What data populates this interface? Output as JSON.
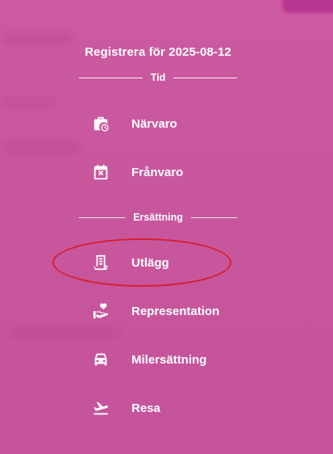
{
  "title": "Registrera för 2025-08-12",
  "sections": [
    {
      "heading": "Tid",
      "items": [
        {
          "label": "Närvaro",
          "icon": "briefcase-clock-icon"
        },
        {
          "label": "Frånvaro",
          "icon": "calendar-x-icon"
        }
      ]
    },
    {
      "heading": "Ersättning",
      "items": [
        {
          "label": "Utlägg",
          "icon": "receipt-icon"
        },
        {
          "label": "Representation",
          "icon": "hand-heart-icon"
        },
        {
          "label": "Milersättning",
          "icon": "car-icon"
        },
        {
          "label": "Resa",
          "icon": "airplane-departure-icon"
        }
      ]
    }
  ],
  "annotation": {
    "color": "#d42030",
    "target": "Utlägg"
  },
  "colors": {
    "background": "#c9579e",
    "text": "#ffffff"
  }
}
